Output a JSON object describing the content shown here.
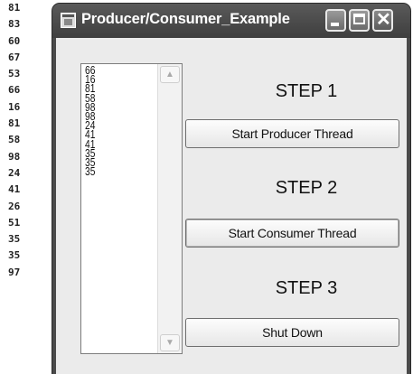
{
  "console": {
    "lines": [
      "81",
      "83",
      "60",
      "67",
      "53",
      "66",
      "16",
      "81",
      "58",
      "98",
      "24",
      "41",
      "26",
      "51",
      "35",
      "35",
      "97"
    ]
  },
  "window": {
    "title": "Producer/Consumer_Example",
    "close_glyph": "✕"
  },
  "listbox": {
    "items": [
      "66",
      "16",
      "81",
      "58",
      "98",
      "98",
      "24",
      "41",
      "41",
      "35",
      "35",
      "35"
    ],
    "scroll_up_glyph": "▲",
    "scroll_down_glyph": "▼"
  },
  "steps": {
    "step1": "STEP 1",
    "step2": "STEP 2",
    "step3": "STEP 3"
  },
  "buttons": {
    "start_producer": "Start Producer Thread",
    "start_consumer": "Start Consumer Thread",
    "shut_down": "Shut Down"
  }
}
